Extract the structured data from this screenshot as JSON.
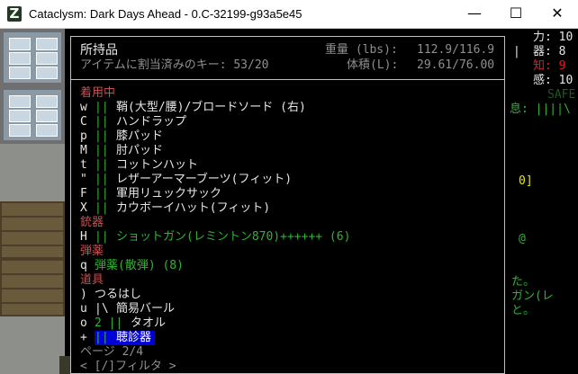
{
  "window": {
    "title": "Cataclysm: Dark Days Ahead - 0.C-32199-g93a5e45",
    "icon_glyph": "Z",
    "minimize": "—",
    "maximize": "☐",
    "close": "✕"
  },
  "inventory": {
    "title": "所持品",
    "assigned_keys": "アイテムに割当済みのキー: 53/20",
    "weight_label": "重量 (lbs):",
    "weight_value": "112.9/116.9",
    "volume_label": "体積(L):",
    "volume_value": "29.61/76.00",
    "sections": [
      {
        "header": "着用中",
        "items": [
          {
            "key": "w",
            "sep": "||",
            "name": "鞘(大型/腰)/ブロードソード (右)"
          },
          {
            "key": "C",
            "sep": "||",
            "name": "ハンドラップ"
          },
          {
            "key": "p",
            "sep": "||",
            "name": "膝パッド"
          },
          {
            "key": "M",
            "sep": "||",
            "name": "肘パッド"
          },
          {
            "key": "t",
            "sep": "||",
            "name": "コットンハット"
          },
          {
            "key": "\"",
            "sep": "||",
            "name": "レザーアーマーブーツ(フィット)"
          },
          {
            "key": "F",
            "sep": "||",
            "name": "軍用リュックサック"
          },
          {
            "key": "X",
            "sep": "||",
            "name": "カウボーイハット(フィット)"
          }
        ]
      },
      {
        "header": "銃器",
        "items": [
          {
            "key": "H",
            "sep": "||",
            "name": "ショットガン(レミントン870)++++++ (6)"
          }
        ]
      },
      {
        "header": "弾薬",
        "items": [
          {
            "key": "q",
            "sep": "",
            "name": "弾薬(散弾) (8)"
          }
        ]
      },
      {
        "header": "道具",
        "items": [
          {
            "key": ")",
            "sep": "",
            "name": "つるはし"
          },
          {
            "key": "u",
            "sep": "|\\",
            "name": "簡易バール"
          },
          {
            "key": "o",
            "sep": "2 ||",
            "name": "タオル"
          },
          {
            "key": "+",
            "sep": "||",
            "name": "聴診器"
          }
        ]
      }
    ],
    "page": "ページ 2/4",
    "filter": "< [/]フィルタ >"
  },
  "side_panel": {
    "stat_str": "力: 10",
    "stat_dex": "器: 8",
    "stat_int": "知: 9",
    "stat_per": "感: 10",
    "safe": "SAFE",
    "breath": "息: ||||\\",
    "bracket": "0]",
    "at_sign": "@",
    "msg1": "た。",
    "msg2": "ガン(レ",
    "msg3": "と。",
    "bar_glyph": "|"
  },
  "colors": {
    "section_header": "#c85050",
    "green_text": "#2fb52f",
    "selection_bg": "#0000d8",
    "stat_red": "#e02020"
  }
}
